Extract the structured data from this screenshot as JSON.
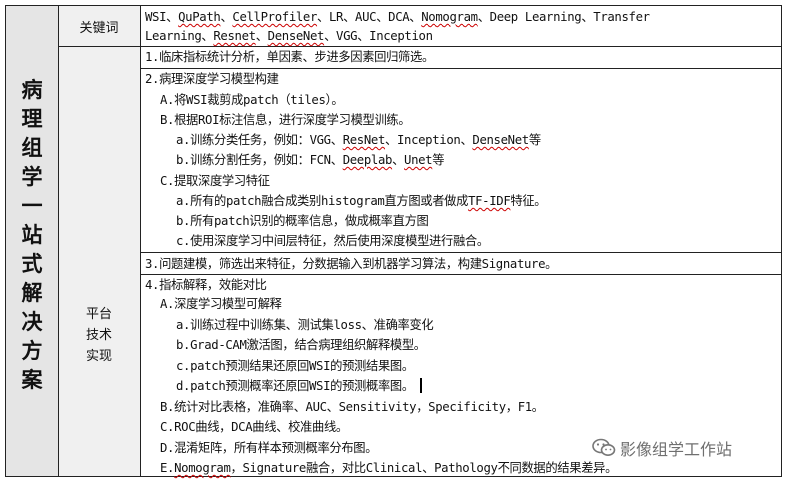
{
  "title_chars": [
    "病",
    "理",
    "组",
    "学",
    "一",
    "站",
    "式",
    "解",
    "决",
    "方",
    "案"
  ],
  "keywords": {
    "label": "关键词",
    "line1_a": "WSI、",
    "line1_qupath": "QuPath",
    "line1_b": "、",
    "line1_cellprofiler": "CellProfiler",
    "line1_c": "、LR、AUC、DCA、",
    "line1_nomogram": "Nomogram",
    "line1_d": "、Deep Learning、Transfer",
    "line2_a": "Learning、",
    "line2_resnet": "Resnet",
    "line2_b": "、",
    "line2_densenet": "DenseNet",
    "line2_c": "、VGG、Inception"
  },
  "platform": {
    "label_1": "平台",
    "label_2": "技术",
    "label_3": "实现"
  },
  "rows": {
    "r1": "1.临床指标统计分析，单因素、步进多因素回归筛选。",
    "r2_head": "2.病理深度学习模型构建",
    "r2_a": "A.将WSI裁剪成patch（tiles）。",
    "r2_b": "B.根据ROI标注信息，进行深度学习模型训练。",
    "r2_b_a_1": "a.训练分类任务，例如：VGG、",
    "r2_b_a_resnet": "ResNet",
    "r2_b_a_2": "、Inception、",
    "r2_b_a_densenet": "DenseNet",
    "r2_b_a_3": "等",
    "r2_b_b_1": "b.训练分割任务，例如：FCN、",
    "r2_b_b_deeplab": "Deeplab",
    "r2_b_b_2": "、",
    "r2_b_b_unet": "Unet",
    "r2_b_b_3": "等",
    "r2_c": "C.提取深度学习特征",
    "r2_c_a_1": "a.所有的patch融合成类别histogram直方图或者做成",
    "r2_c_a_tfidf": "TF-IDF",
    "r2_c_a_2": "特征。",
    "r2_c_b": "b.所有patch识别的概率信息，做成概率直方图",
    "r2_c_c": "c.使用深度学习中间层特征，然后使用深度模型进行融合。",
    "r3": "3.问题建模，筛选出来特征，分数据输入到机器学习算法，构建Signature。",
    "r4_head": "4.指标解释，效能对比",
    "r4_a": "A.深度学习模型可解释",
    "r4_a_a": "a.训练过程中训练集、测试集loss、准确率变化",
    "r4_a_b": "b.Grad-CAM激活图，结合病理组织解释模型。",
    "r4_a_c": "c.patch预测结果还原回WSI的预测结果图。",
    "r4_a_d": "d.patch预测概率还原回WSI的预测概率图。",
    "r4_b": "B.统计对比表格，准确率、AUC、Sensitivity，Specificity，F1。",
    "r4_c": "C.ROC曲线，DCA曲线、校准曲线。",
    "r4_d": "D.混淆矩阵，所有样本预测概率分布图。",
    "r4_e_1": "E.",
    "r4_e_nomogram": "Nomogram",
    "r4_e_2": "，Signature融合，对比Clinical、Pathology不同数据的结果差异。"
  },
  "watermark": {
    "icon": "wechat-icon",
    "text": "影像组学工作站"
  }
}
